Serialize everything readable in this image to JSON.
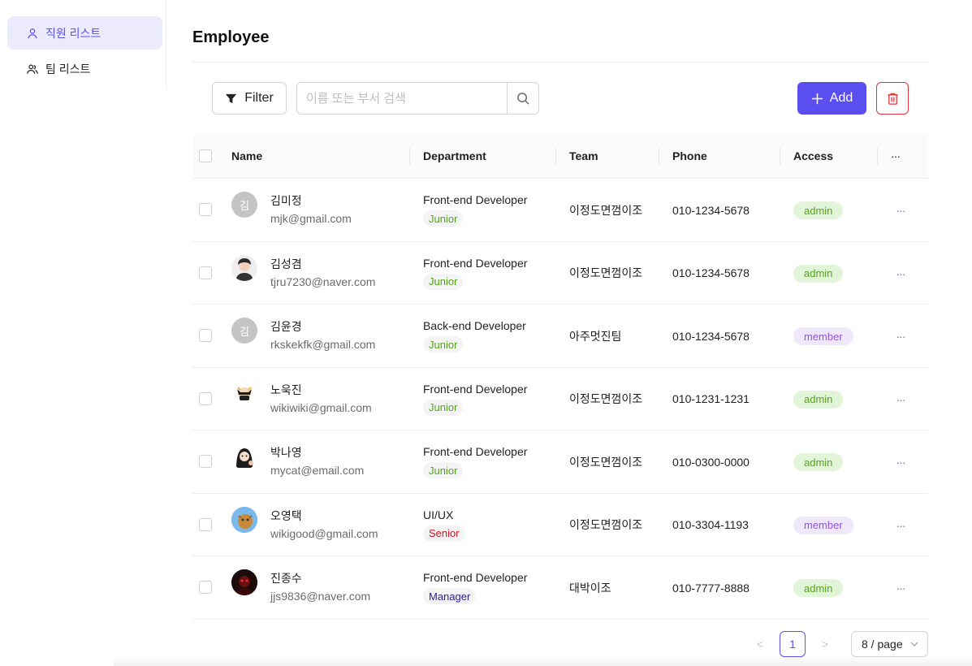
{
  "sidebar": {
    "items": [
      {
        "label": "직원 리스트",
        "icon": "user-icon",
        "active": true
      },
      {
        "label": "팀 리스트",
        "icon": "team-icon",
        "active": false
      }
    ]
  },
  "header": {
    "title": "Employee"
  },
  "toolbar": {
    "filter_label": "Filter",
    "search_placeholder": "이름 또는 부서 검색",
    "search_value": "",
    "add_label": "Add"
  },
  "table": {
    "columns": [
      "Name",
      "Department",
      "Team",
      "Phone",
      "Access",
      "···"
    ],
    "rows": [
      {
        "avatar": "김",
        "avatar_type": "letter",
        "name": "김미정",
        "email": "mjk@gmail.com",
        "department": "Front-end Developer",
        "level": "Junior",
        "team": "이정도면껌이조",
        "phone": "010-1234-5678",
        "access": "admin"
      },
      {
        "avatar": "",
        "avatar_type": "photo",
        "name": "김성겸",
        "email": "tjru7230@naver.com",
        "department": "Front-end Developer",
        "level": "Junior",
        "team": "이정도면껌이조",
        "phone": "010-1234-5678",
        "access": "admin"
      },
      {
        "avatar": "김",
        "avatar_type": "letter",
        "name": "김윤경",
        "email": "rkskekfk@gmail.com",
        "department": "Back-end Developer",
        "level": "Junior",
        "team": "아주멋진팀",
        "phone": "010-1234-5678",
        "access": "member"
      },
      {
        "avatar": "",
        "avatar_type": "photo",
        "name": "노욱진",
        "email": "wikiwiki@gmail.com",
        "department": "Front-end Developer",
        "level": "Junior",
        "team": "이정도면껌이조",
        "phone": "010-1231-1231",
        "access": "admin"
      },
      {
        "avatar": "",
        "avatar_type": "photo",
        "name": "박나영",
        "email": "mycat@email.com",
        "department": "Front-end Developer",
        "level": "Junior",
        "team": "이정도면껌이조",
        "phone": "010-0300-0000",
        "access": "admin"
      },
      {
        "avatar": "",
        "avatar_type": "photo",
        "name": "오영택",
        "email": "wikigood@gmail.com",
        "department": "UI/UX",
        "level": "Senior",
        "team": "이정도면껌이조",
        "phone": "010-3304-1193",
        "access": "member"
      },
      {
        "avatar": "",
        "avatar_type": "photo",
        "name": "진종수",
        "email": "jjs9836@naver.com",
        "department": "Front-end Developer",
        "level": "Manager",
        "team": "대박이조",
        "phone": "010-7777-8888",
        "access": "admin"
      }
    ],
    "row_more": "···"
  },
  "pagination": {
    "prev": "<",
    "current": "1",
    "next": ">",
    "page_size": "8 / page"
  },
  "colors": {
    "accent": "#5b4ef0",
    "danger": "#e2343b",
    "junior": "#52a31a",
    "senior": "#cf1322",
    "manager": "#2f1a8c",
    "admin_bg": "#e3f5d8",
    "admin_fg": "#52a31a",
    "member_bg": "#efe8fb",
    "member_fg": "#9254de"
  }
}
